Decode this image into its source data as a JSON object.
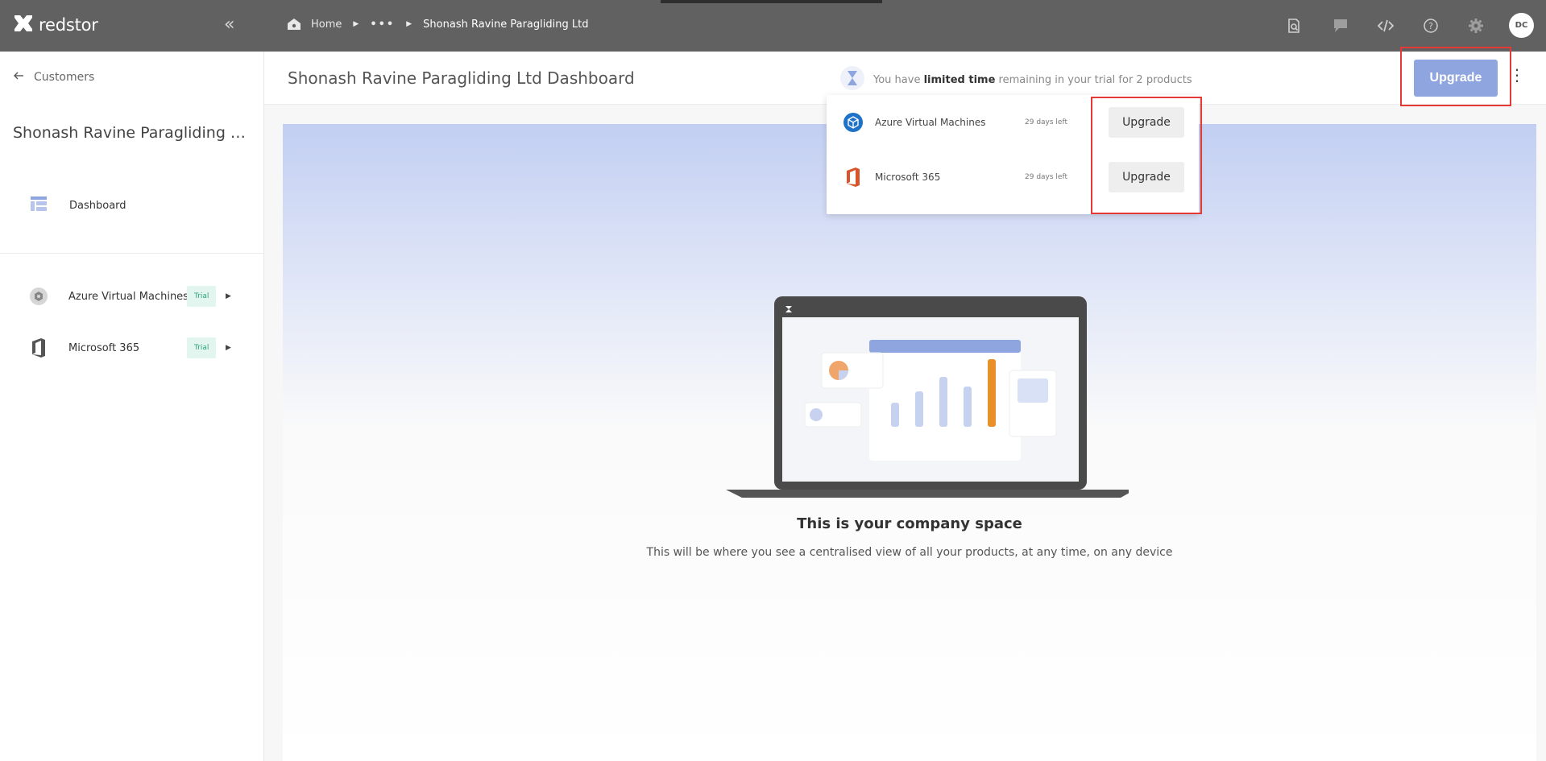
{
  "topbar": {
    "app_name": "redstor",
    "breadcrumb": {
      "home": "Home",
      "ellipsis": "•••",
      "current": "Shonash Ravine Paragliding Ltd"
    },
    "icons": [
      "search-document-icon",
      "chat-icon",
      "code-icon",
      "help-icon",
      "settings-icon"
    ],
    "avatar_initials": "DC"
  },
  "sidebar": {
    "back_label": "Customers",
    "customer_title": "Shonash Ravine Paragliding Ltd",
    "nav": [
      {
        "label": "Dashboard"
      }
    ],
    "products": [
      {
        "name": "Azure Virtual Machines",
        "badge": "Trial"
      },
      {
        "name": "Microsoft 365",
        "badge": "Trial"
      }
    ]
  },
  "header": {
    "title": "Shonash Ravine Paragliding Ltd Dashboard",
    "trial_prefix": "You have ",
    "trial_bold": "limited time",
    "trial_suffix": " remaining in your trial for 2 products",
    "upgrade_label": "Upgrade"
  },
  "popup": {
    "items": [
      {
        "name": "Azure Virtual Machines",
        "days_left": "29 days left",
        "button": "Upgrade"
      },
      {
        "name": "Microsoft 365",
        "days_left": "29 days left",
        "button": "Upgrade"
      }
    ]
  },
  "hero": {
    "title": "This is your company space",
    "subtitle": "This will be where you see a centralised view of all your products, at any time, on any device"
  },
  "colors": {
    "topbar": "#616161",
    "upgrade_button": "#8fa5df",
    "trial_badge_bg": "#e2f5ee",
    "trial_badge_text": "#2fa37a",
    "highlight_box": "#e53935"
  }
}
